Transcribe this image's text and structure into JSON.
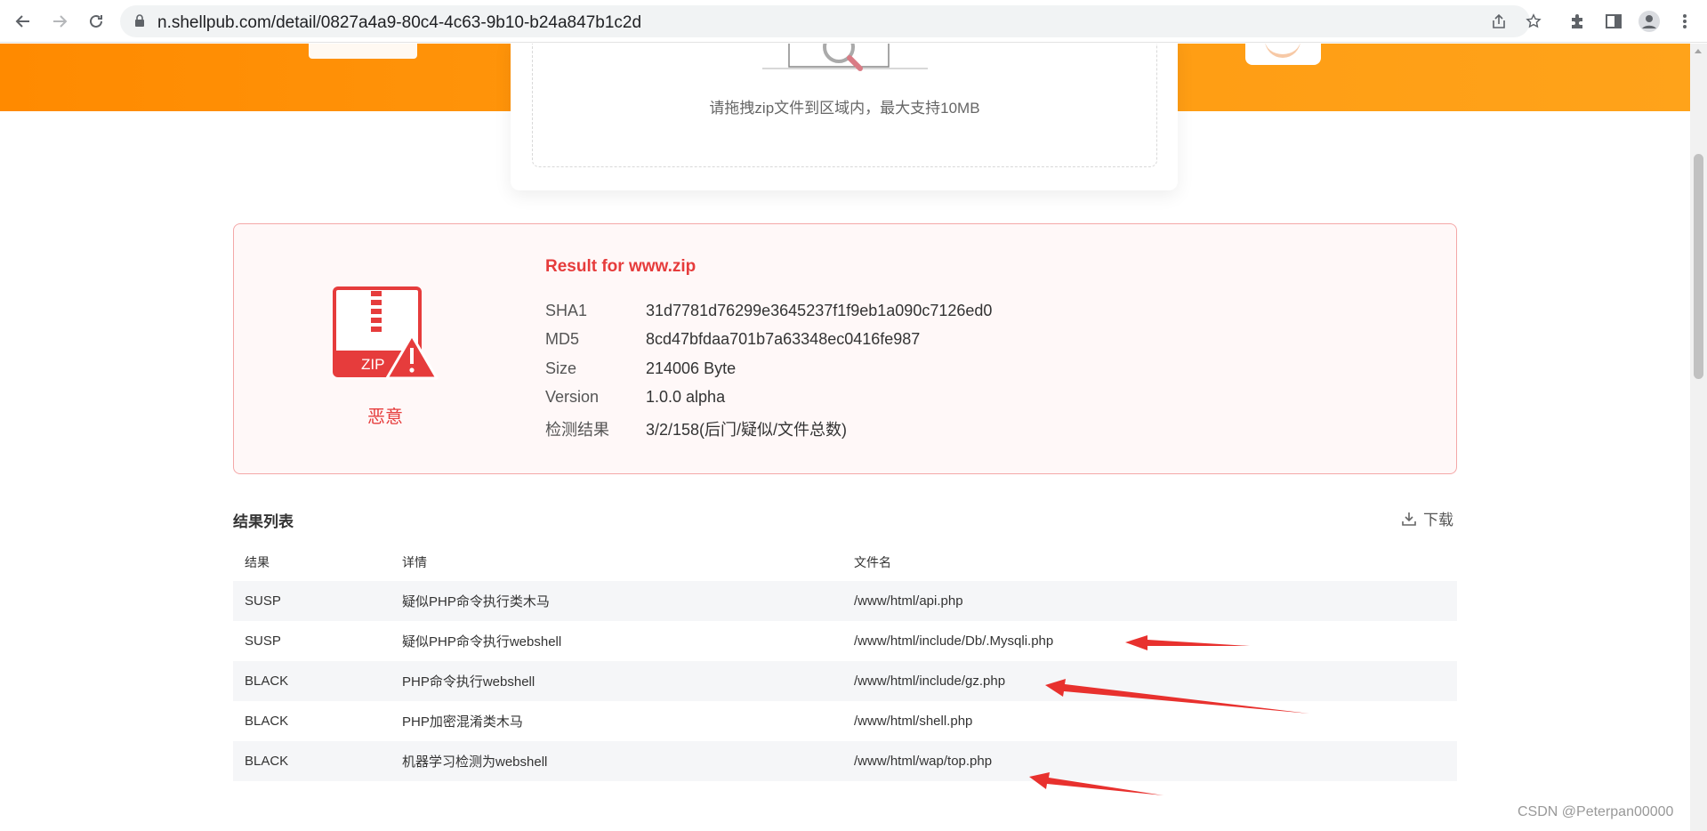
{
  "browser": {
    "url": "n.shellpub.com/detail/0827a4a9-80c4-4c63-9b10-b24a847b1c2d"
  },
  "upload": {
    "hint": "请拖拽zip文件到区域内，最大支持10MB"
  },
  "result": {
    "title": "Result for www.zip",
    "verdict": "恶意",
    "zip_label": "ZIP",
    "rows": [
      {
        "key": "SHA1",
        "value": "31d7781d76299e3645237f1f9eb1a090c7126ed0"
      },
      {
        "key": "MD5",
        "value": "8cd47bfdaa701b7a63348ec0416fe987"
      },
      {
        "key": "Size",
        "value": "214006 Byte"
      },
      {
        "key": "Version",
        "value": "1.0.0 alpha"
      },
      {
        "key": "检测结果",
        "value": "3/2/158(后门/疑似/文件总数)"
      }
    ]
  },
  "list": {
    "title": "结果列表",
    "download_label": "下载",
    "headers": [
      "结果",
      "详情",
      "文件名"
    ],
    "rows": [
      {
        "result": "SUSP",
        "detail": "疑似PHP命令执行类木马",
        "file": "/www/html/api.php"
      },
      {
        "result": "SUSP",
        "detail": "疑似PHP命令执行webshell",
        "file": "/www/html/include/Db/.Mysqli.php"
      },
      {
        "result": "BLACK",
        "detail": "PHP命令执行webshell",
        "file": "/www/html/include/gz.php"
      },
      {
        "result": "BLACK",
        "detail": "PHP加密混淆类木马",
        "file": "/www/html/shell.php"
      },
      {
        "result": "BLACK",
        "detail": "机器学习检测为webshell",
        "file": "/www/html/wap/top.php"
      }
    ]
  },
  "watermark": "CSDN @Peterpan00000",
  "colors": {
    "banner": "#ff9a10",
    "danger": "#e63c3c",
    "annotation_arrow": "#e8312e"
  }
}
